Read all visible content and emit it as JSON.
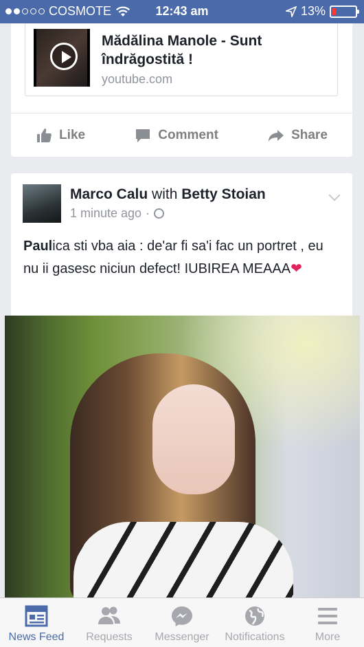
{
  "status_bar": {
    "carrier": "COSMOTE",
    "time": "12:43 am",
    "battery": "13%",
    "battery_level": 0.13
  },
  "shared_link": {
    "title": "Mădălina Manole - Sunt îndrăgostită !",
    "domain": "youtube.com"
  },
  "actions": {
    "like": "Like",
    "comment": "Comment",
    "share": "Share"
  },
  "post": {
    "author": "Marco Calu",
    "with_word": "with",
    "tagged": "Betty Stoian",
    "time": "1 minute ago",
    "separator": "·",
    "text_bold": "Paul",
    "text_rest": "ica sti vba aia : de'ar fi sa'i fac un portret , eu nu ii gasesc niciun defect! IUBIREA MEAAA",
    "emoji": "❤"
  },
  "tabs": [
    {
      "label": "News Feed",
      "icon": "news-feed-icon",
      "active": true
    },
    {
      "label": "Requests",
      "icon": "friends-icon",
      "active": false
    },
    {
      "label": "Messenger",
      "icon": "messenger-icon",
      "active": false
    },
    {
      "label": "Notifications",
      "icon": "globe-icon",
      "active": false
    },
    {
      "label": "More",
      "icon": "menu-icon",
      "active": false
    }
  ],
  "colors": {
    "brand": "#4a6aa9",
    "battery_low": "#ff3b30"
  }
}
